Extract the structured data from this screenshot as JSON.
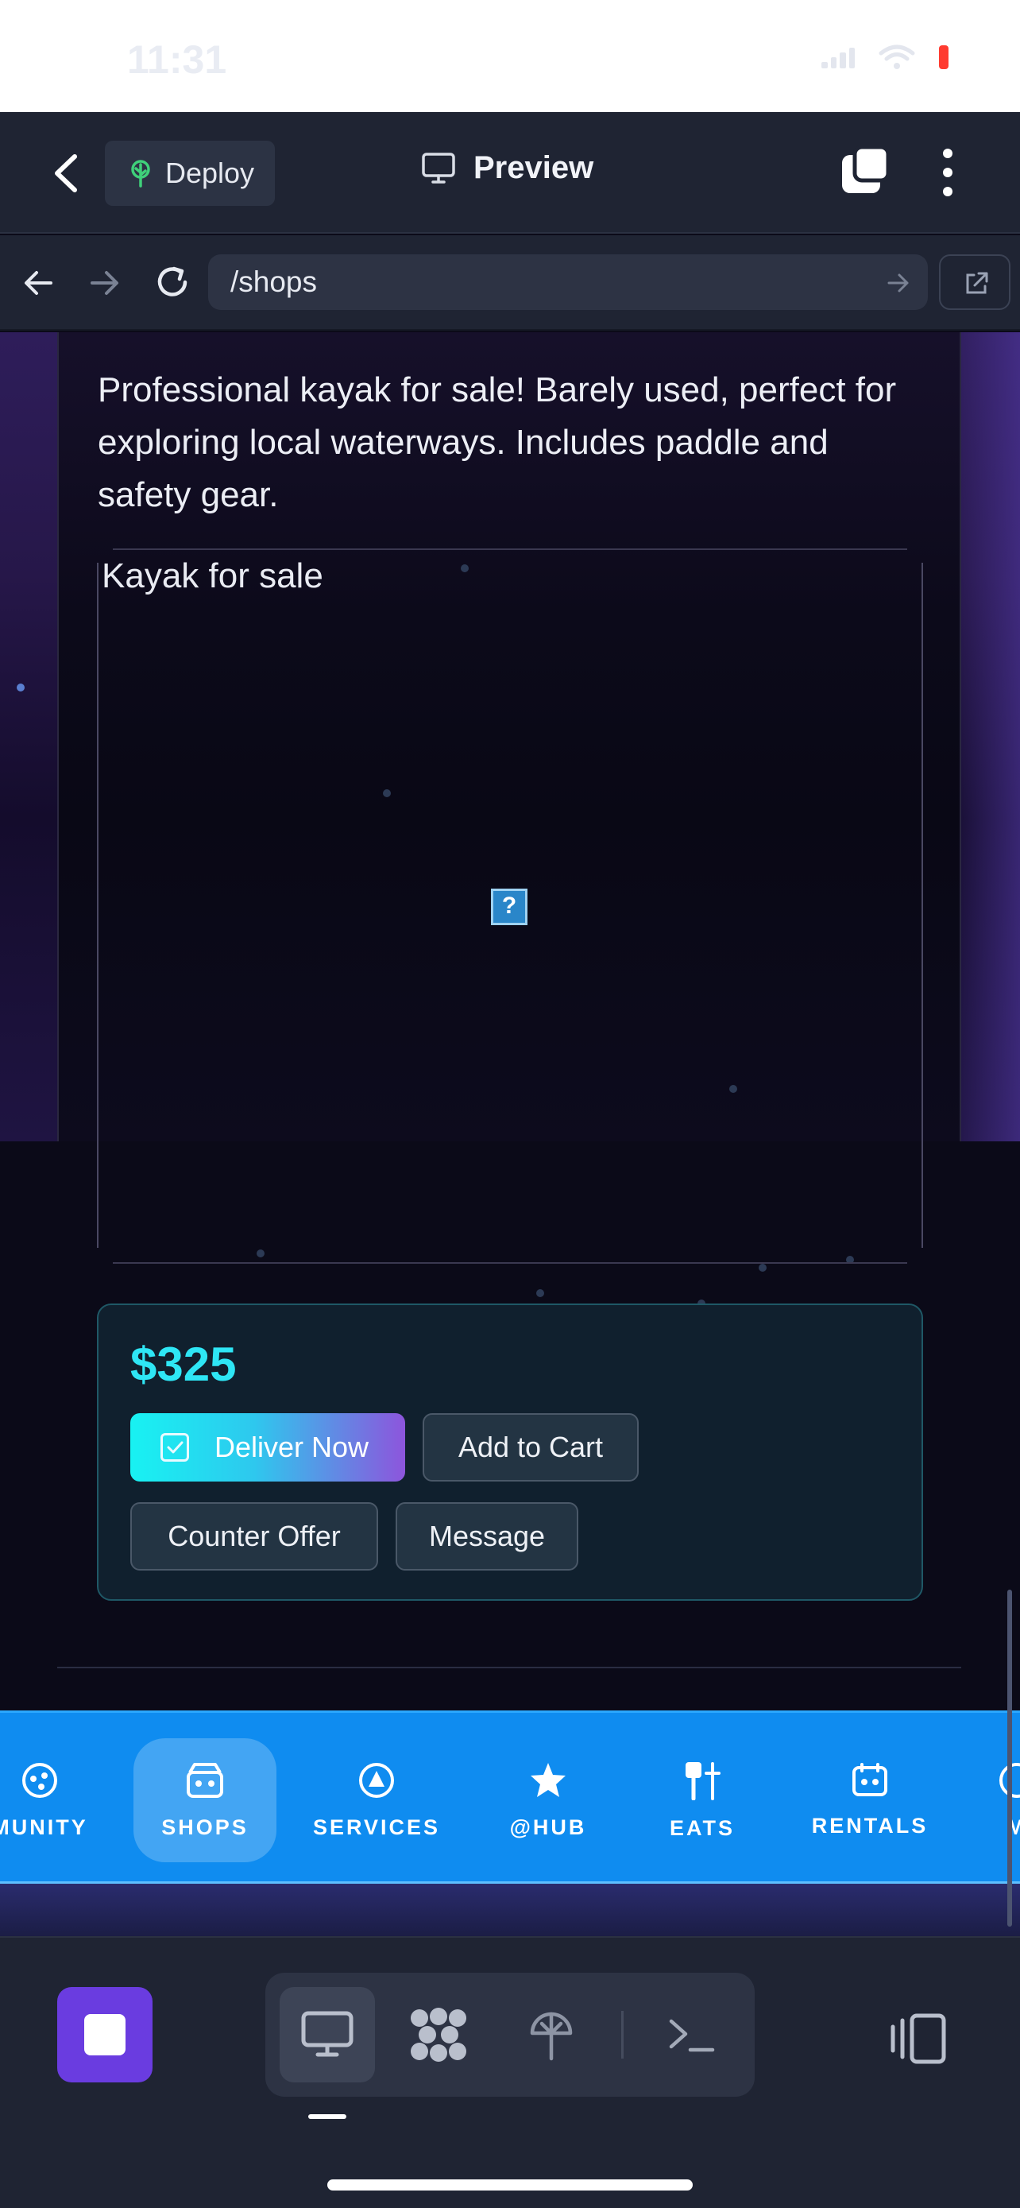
{
  "status_bar": {
    "time": "11:31"
  },
  "app_bar": {
    "deploy_label": "Deploy",
    "title": "Preview"
  },
  "browser": {
    "url": "/shops"
  },
  "listing": {
    "description": "Professional kayak for sale! Barely used, perfect for exploring local waterways. Includes paddle and safety gear.",
    "image_alt": "Kayak for sale",
    "broken_image_glyph": "?",
    "price": "$325",
    "actions": {
      "deliver_now": "Deliver Now",
      "add_to_cart": "Add to Cart",
      "counter_offer": "Counter Offer",
      "message": "Message"
    }
  },
  "category_nav": {
    "items": [
      {
        "label": "MUNITY",
        "icon": "community-icon"
      },
      {
        "label": "SHOPS",
        "icon": "shop-icon",
        "active": true
      },
      {
        "label": "SERVICES",
        "icon": "services-icon"
      },
      {
        "label": "@HUB",
        "icon": "star-icon"
      },
      {
        "label": "EATS",
        "icon": "utensils-icon"
      },
      {
        "label": "RENTALS",
        "icon": "rentals-icon"
      },
      {
        "label": "M",
        "icon": "more-category-icon"
      }
    ]
  },
  "dock": {
    "items": [
      "preview-desktop-icon",
      "pattern-icon",
      "deploy-tree-icon",
      "terminal-icon"
    ],
    "active": "preview-desktop-icon"
  },
  "colors": {
    "accent_cyan": "#2ee6f5",
    "nav_blue": "#0f8cf0",
    "stop_purple": "#6a3ce0",
    "chrome": "#1f2433"
  }
}
